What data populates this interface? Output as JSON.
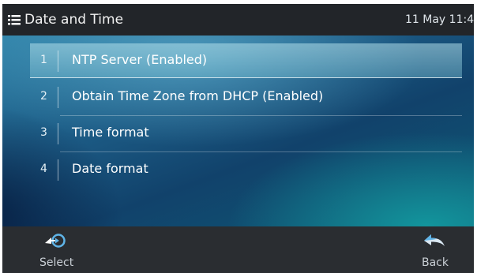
{
  "header": {
    "title": "Date and Time",
    "clock": "11 May 11:4",
    "menu_icon": "menu-list-icon"
  },
  "menu": {
    "items": [
      {
        "number": "1",
        "label": "NTP Server (Enabled)",
        "selected": true
      },
      {
        "number": "2",
        "label": "Obtain Time Zone from DHCP (Enabled)",
        "selected": false
      },
      {
        "number": "3",
        "label": "Time format",
        "selected": false
      },
      {
        "number": "4",
        "label": "Date format",
        "selected": false
      }
    ]
  },
  "softkeys": {
    "select": {
      "label": "Select",
      "icon": "select-arrow-icon"
    },
    "back": {
      "label": "Back",
      "icon": "back-arrow-icon"
    }
  },
  "colors": {
    "titlebar": "#222529",
    "softkey_bar": "#2a2d31",
    "accent_icon": "#5fb4e8"
  }
}
